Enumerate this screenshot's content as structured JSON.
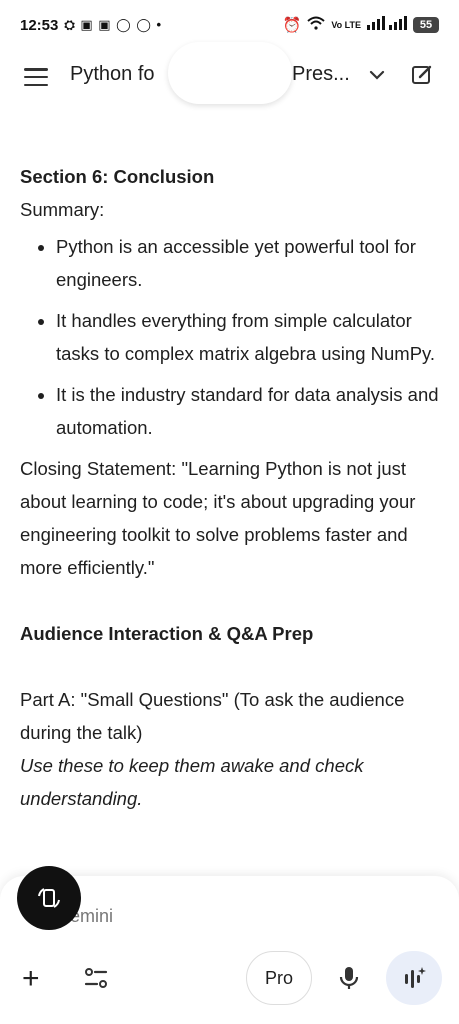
{
  "status": {
    "time": "12:53",
    "notification_icons": "⛭ ▣ ▣ ◯ ◯ •",
    "network_label": "Vo LTE",
    "battery": "55"
  },
  "appbar": {
    "title_start": "Python fo",
    "title_end": "Pres..."
  },
  "content": {
    "section_heading": "Section 6: Conclusion",
    "summary_label": "Summary:",
    "bullets": [
      "Python is an accessible yet powerful tool for engineers.",
      "It handles everything from simple calculator tasks to complex matrix algebra using NumPy.",
      "It is the industry standard for data analysis and automation."
    ],
    "closing_label": "Closing Statement:",
    "closing_text": " \"Learning Python is not just about learning to code; it's about upgrading your engineering toolkit to solve problems faster and more efficiently.\"",
    "qa_heading": "Audience Interaction & Q&A Prep",
    "part_a": "Part A: \"Small Questions\" (To ask the audience during the talk)",
    "part_a_note": "Use these to keep them awake and check understanding."
  },
  "composer": {
    "placeholder": "emini",
    "pro_label": "Pro"
  },
  "colors": {
    "accent": "#e9eef9",
    "fab": "#111111"
  }
}
